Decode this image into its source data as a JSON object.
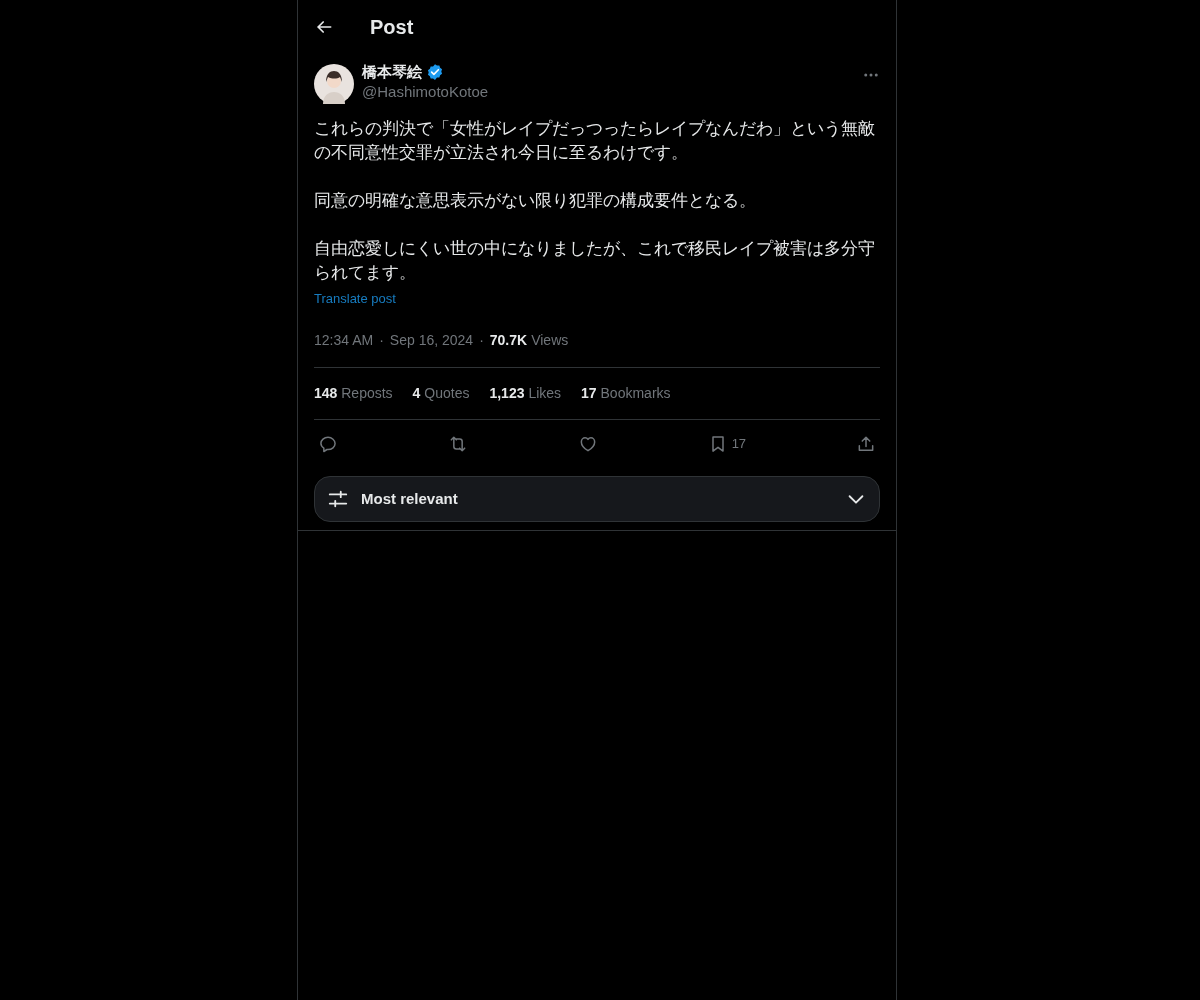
{
  "header": {
    "title": "Post"
  },
  "author": {
    "name": "橋本琴絵",
    "verified": true,
    "handle": "@HashimotoKotoe"
  },
  "paragraphs": [
    "これらの判決で「女性がレイプだっつったらレイプなんだわ」という無敵の不同意性交罪が立法され今日に至るわけです。",
    "同意の明確な意思表示がない限り犯罪の構成要件となる。",
    "自由恋愛しにくい世の中になりましたが、これで移民レイプ被害は多分守られてます。"
  ],
  "translate_link": "Translate post",
  "meta": {
    "time": "12:34 AM",
    "separator": "·",
    "date": "Sep 16, 2024",
    "views_count": "70.7K",
    "views_label": "Views"
  },
  "stats": [
    {
      "count": "148",
      "label": "Reposts"
    },
    {
      "count": "4",
      "label": "Quotes"
    },
    {
      "count": "1,123",
      "label": "Likes"
    },
    {
      "count": "17",
      "label": "Bookmarks"
    }
  ],
  "actions": [
    {
      "kind": "reply"
    },
    {
      "kind": "repost"
    },
    {
      "kind": "like"
    },
    {
      "kind": "bookmark",
      "count": "17"
    },
    {
      "kind": "share"
    }
  ],
  "sort": {
    "label": "Most relevant"
  }
}
